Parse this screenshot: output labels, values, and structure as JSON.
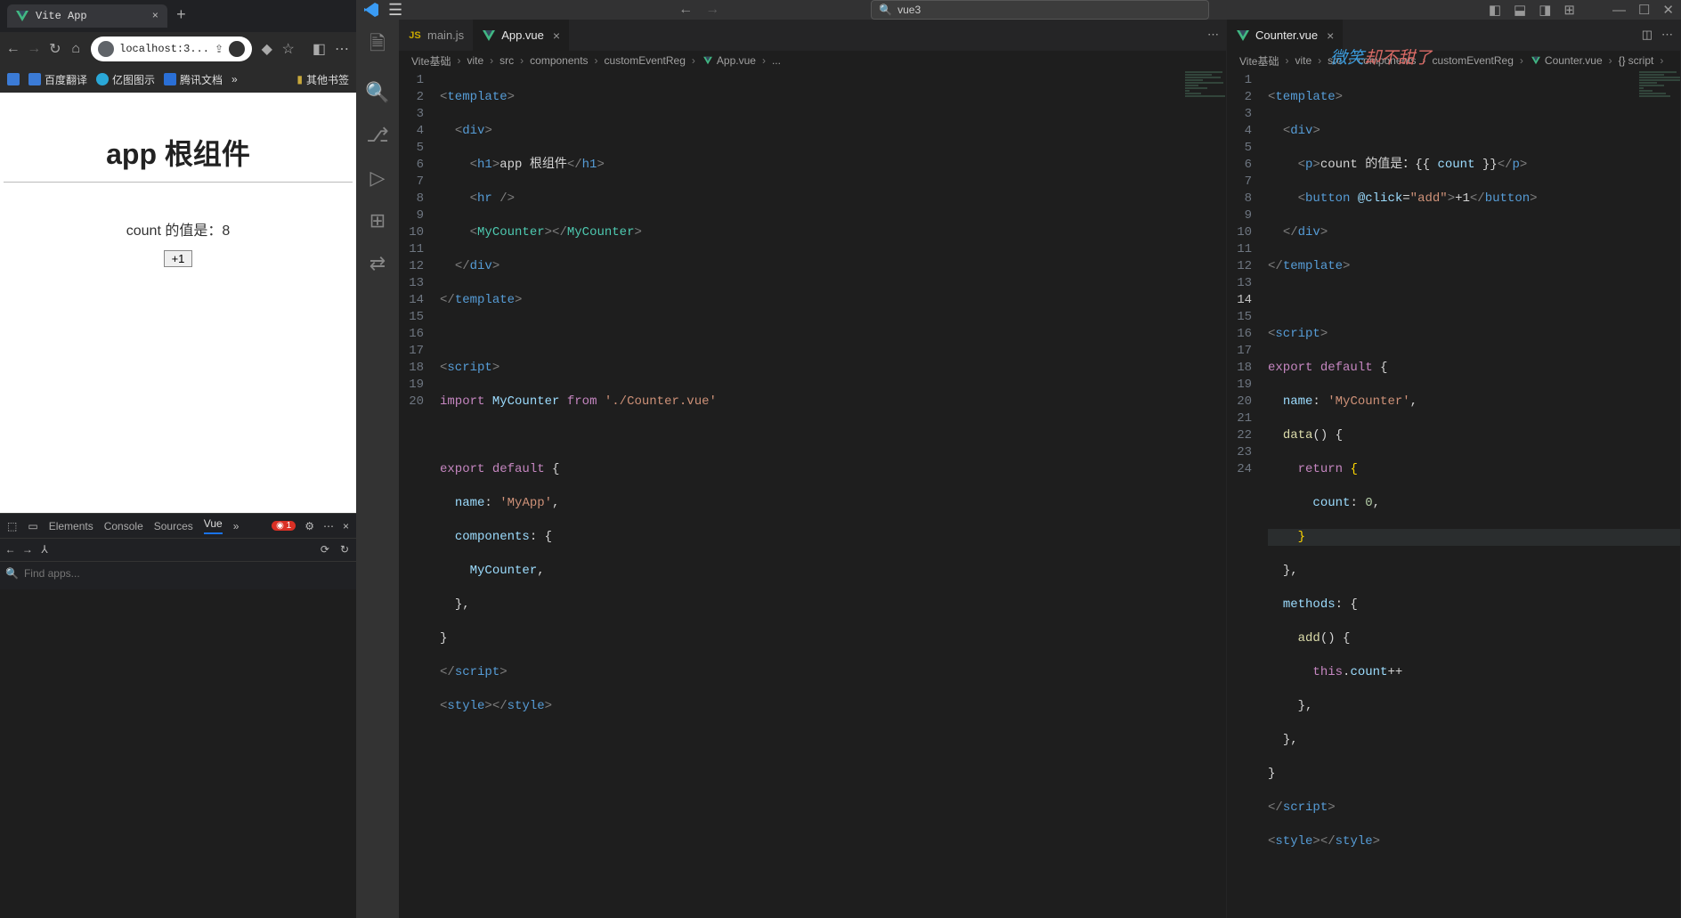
{
  "browser": {
    "tab_title": "Vite App",
    "address": "localhost:3...",
    "bookmarks": [
      {
        "label": "",
        "color": "#3b7bd6"
      },
      {
        "label": "百度翻译",
        "color": "#3b7bd6"
      },
      {
        "label": "亿图图示",
        "color": "#2aa8d8"
      },
      {
        "label": "腾讯文档",
        "color": "#2a6fd6"
      }
    ],
    "bookmark_more": "»",
    "bookmark_folder": "其他书签",
    "page": {
      "h1": "app 根组件",
      "count_label": "count 的值是：",
      "count_value": "8",
      "button_label": "+1"
    },
    "devtools": {
      "tabs": [
        "Elements",
        "Console",
        "Sources",
        "Vue"
      ],
      "active_tab": "Vue",
      "more": "»",
      "error_count": "1",
      "search_placeholder": "Find apps..."
    }
  },
  "vscode": {
    "search_value": "vue3",
    "watermark_cn": "微笑",
    "watermark_rest": "却不甜了",
    "activity": [
      "files",
      "search",
      "source-control",
      "run",
      "extensions",
      "remote"
    ],
    "editor_left": {
      "tabs": [
        {
          "name": "main.js",
          "kind": "js",
          "active": false
        },
        {
          "name": "App.vue",
          "kind": "vue",
          "active": true
        }
      ],
      "breadcrumbs": [
        "Vite基础",
        "vite",
        "src",
        "components",
        "customEventReg",
        "App.vue",
        "..."
      ],
      "line_count": 20,
      "code": {
        "l1": {
          "tag": "template"
        },
        "l2": {
          "tag": "div"
        },
        "l3": {
          "open": "h1",
          "text": "app 根组件",
          "close": "h1"
        },
        "l4": {
          "self": "hr"
        },
        "l5": {
          "open": "MyCounter",
          "close": "MyCounter"
        },
        "l6": {
          "close": "div"
        },
        "l7": {
          "close": "template"
        },
        "l9": {
          "open": "script"
        },
        "l10": {
          "import": "MyCounter",
          "from": "'./Counter.vue'"
        },
        "l12": {
          "export_default": "{"
        },
        "l13": {
          "key": "name",
          "val": "'MyApp'",
          "comma": ","
        },
        "l14": {
          "key": "components",
          "open": "{"
        },
        "l15": {
          "ident": "MyCounter",
          "comma": ","
        },
        "l16": {
          "close": "}",
          "comma": ","
        },
        "l17": {
          "close": "}"
        },
        "l18": {
          "close_tag": "script"
        },
        "l19": {
          "open": "style",
          "close": "style"
        }
      }
    },
    "editor_right": {
      "tabs": [
        {
          "name": "Counter.vue",
          "kind": "vue",
          "active": true
        }
      ],
      "breadcrumbs": [
        "Vite基础",
        "vite",
        "src",
        "components",
        "customEventReg",
        "Counter.vue",
        "script"
      ],
      "line_count": 24,
      "active_line": 14,
      "code": {
        "l1": {
          "tag": "template"
        },
        "l2": {
          "tag": "div"
        },
        "l3": {
          "p_text": "count 的值是：",
          "mustache": "count"
        },
        "l4": {
          "btn_event": "@click",
          "handler": "\"add\"",
          "btn_text": "+1"
        },
        "l5": {
          "close": "div"
        },
        "l6": {
          "close": "template"
        },
        "l8": {
          "open": "script"
        },
        "l9": {
          "export_default": "{"
        },
        "l10": {
          "key": "name",
          "val": "'MyCounter'",
          "comma": ","
        },
        "l11": {
          "fn": "data",
          "open": "{"
        },
        "l12": {
          "return": "{"
        },
        "l13": {
          "key": "count",
          "val": "0",
          "comma": ","
        },
        "l14": {
          "brc": "}"
        },
        "l15": {
          "close": "}",
          "comma": ","
        },
        "l16": {
          "key": "methods",
          "open": "{"
        },
        "l17": {
          "fn": "add",
          "open": "{"
        },
        "l18": {
          "this": "count",
          "op": "++"
        },
        "l19": {
          "close": "}",
          "comma": ","
        },
        "l20": {
          "close": "}",
          "comma": ","
        },
        "l21": {
          "close": "}"
        },
        "l22": {
          "close_tag": "script"
        },
        "l23": {
          "open": "style",
          "close": "style"
        }
      }
    }
  }
}
